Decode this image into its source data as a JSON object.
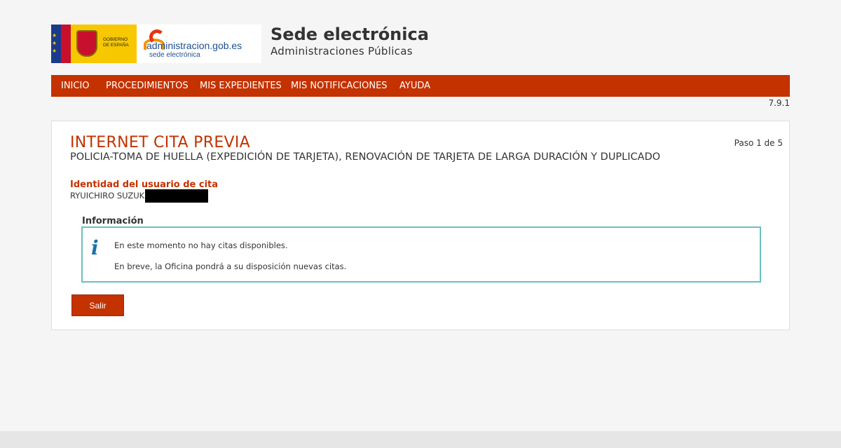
{
  "header": {
    "gov_text_line1": "GOBIERNO",
    "gov_text_line2": "DE ESPAÑA",
    "adm_name": "administracion.gob.es",
    "adm_sub": "sede electrónica",
    "site_title": "Sede electrónica",
    "site_subtitle": "Administraciones Públicas"
  },
  "nav": {
    "items": [
      "INICIO",
      "PROCEDIMIENTOS",
      "MIS EXPEDIENTES",
      "MIS NOTIFICACIONES",
      "AYUDA"
    ]
  },
  "version": "7.9.1",
  "panel": {
    "title": "INTERNET CITA PREVIA",
    "subtitle": "POLICIA-TOMA DE HUELLA (EXPEDICIÓN DE TARJETA), RENOVACIÓN DE TARJETA DE LARGA DURACIÓN Y DUPLICADO",
    "step": "Paso 1 de 5",
    "identity_label": "Identidad del usuario de cita",
    "identity_name": "RYUICHIRO SUZUKI",
    "info_heading": "Información",
    "info_icon": "i",
    "info_line1": "En este momento no hay citas disponibles.",
    "info_line2": "En breve, la Oficina pondrá a su disposición nuevas citas.",
    "exit_label": "Salir"
  },
  "colors": {
    "accent": "#c43200",
    "info_border": "#6cbfbf",
    "background": "#f5f5f5"
  }
}
